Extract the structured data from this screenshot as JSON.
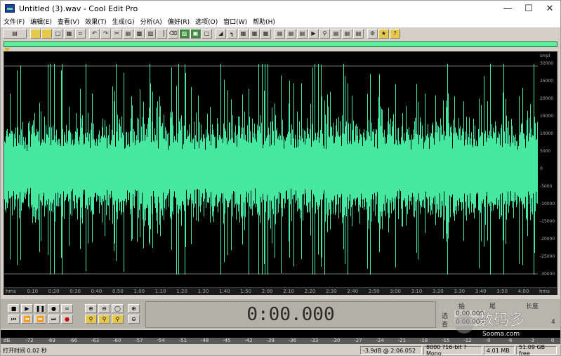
{
  "window": {
    "title": "Untitled (3).wav - Cool Edit Pro",
    "controls": [
      "minimize",
      "maximize",
      "close"
    ]
  },
  "menubar": {
    "items": [
      "文件(F)",
      "编辑(E)",
      "查看(V)",
      "效果(T)",
      "生成(G)",
      "分析(A)",
      "偏好(R)",
      "选项(O)",
      "窗口(W)",
      "帮助(H)"
    ]
  },
  "toolbar": {
    "buttons": [
      "mode-switch",
      "new",
      "open",
      "save",
      "save-all",
      "close",
      "undo",
      "redo",
      "cut",
      "copy",
      "paste",
      "paste-mix",
      "trim",
      "delete",
      "silence",
      "select-all",
      "snap",
      "normalize",
      "fade",
      "mute",
      "effects-list",
      "spectral",
      "waveform",
      "view-mode",
      "zoom",
      "cue-list",
      "play-list",
      "info",
      "help"
    ]
  },
  "waveform": {
    "amp_label": "smpl",
    "amp_ticks": [
      "30000",
      "25000",
      "20000",
      "15000",
      "10000",
      "5000",
      "0",
      "-5000",
      "-10000",
      "-15000",
      "-20000",
      "-25000",
      "-30000"
    ],
    "time_ticks": [
      "hms",
      "0:10",
      "0:20",
      "0:30",
      "0:40",
      "0:50",
      "1:00",
      "1:10",
      "1:20",
      "1:30",
      "1:40",
      "1:50",
      "2:00",
      "2:10",
      "2:20",
      "2:30",
      "2:40",
      "2:50",
      "3:00",
      "3:10",
      "3:20",
      "3:30",
      "3:40",
      "3:50",
      "4:00",
      "hms"
    ],
    "colors": {
      "wave": "#46e8a0",
      "background": "#000000",
      "grid": "#777777"
    }
  },
  "transport": {
    "row1": [
      "stop",
      "play",
      "pause",
      "play-from-cursor",
      "loop"
    ],
    "row2": [
      "go-start",
      "rewind",
      "fast-forward",
      "go-end",
      "record"
    ],
    "zoom_row1": [
      "zoom-in",
      "zoom-out",
      "zoom-full",
      "zoom-in-vertical"
    ],
    "zoom_row2": [
      "zoom-selection",
      "zoom-left",
      "zoom-right",
      "zoom-out-vertical"
    ]
  },
  "time_display": "0:00.000",
  "selection_panel": {
    "headers": [
      "始",
      "尾",
      "长度"
    ],
    "row_labels": [
      "选",
      "查"
    ],
    "values": [
      "0:00.000",
      "0:00.000",
      "4"
    ]
  },
  "level_meter": {
    "ticks": [
      "dB",
      "-72",
      "-69",
      "-66",
      "-63",
      "-60",
      "-57",
      "-54",
      "-51",
      "-48",
      "-45",
      "-42",
      "-39",
      "-36",
      "-33",
      "-30",
      "-27",
      "-24",
      "-21",
      "-18",
      "-15",
      "-12",
      "-9",
      "-6",
      "-3",
      "0"
    ]
  },
  "statusbar": {
    "status": "打开时间 0.02 秒",
    "level": "-3.9dB @ 2:06.052",
    "format": "8000 ?16-bit ?Mono",
    "file_size": "4.01 MB",
    "free_space": "51.09 GB free"
  },
  "watermark": {
    "main": "数码多",
    "sub": "Sooma.com"
  }
}
